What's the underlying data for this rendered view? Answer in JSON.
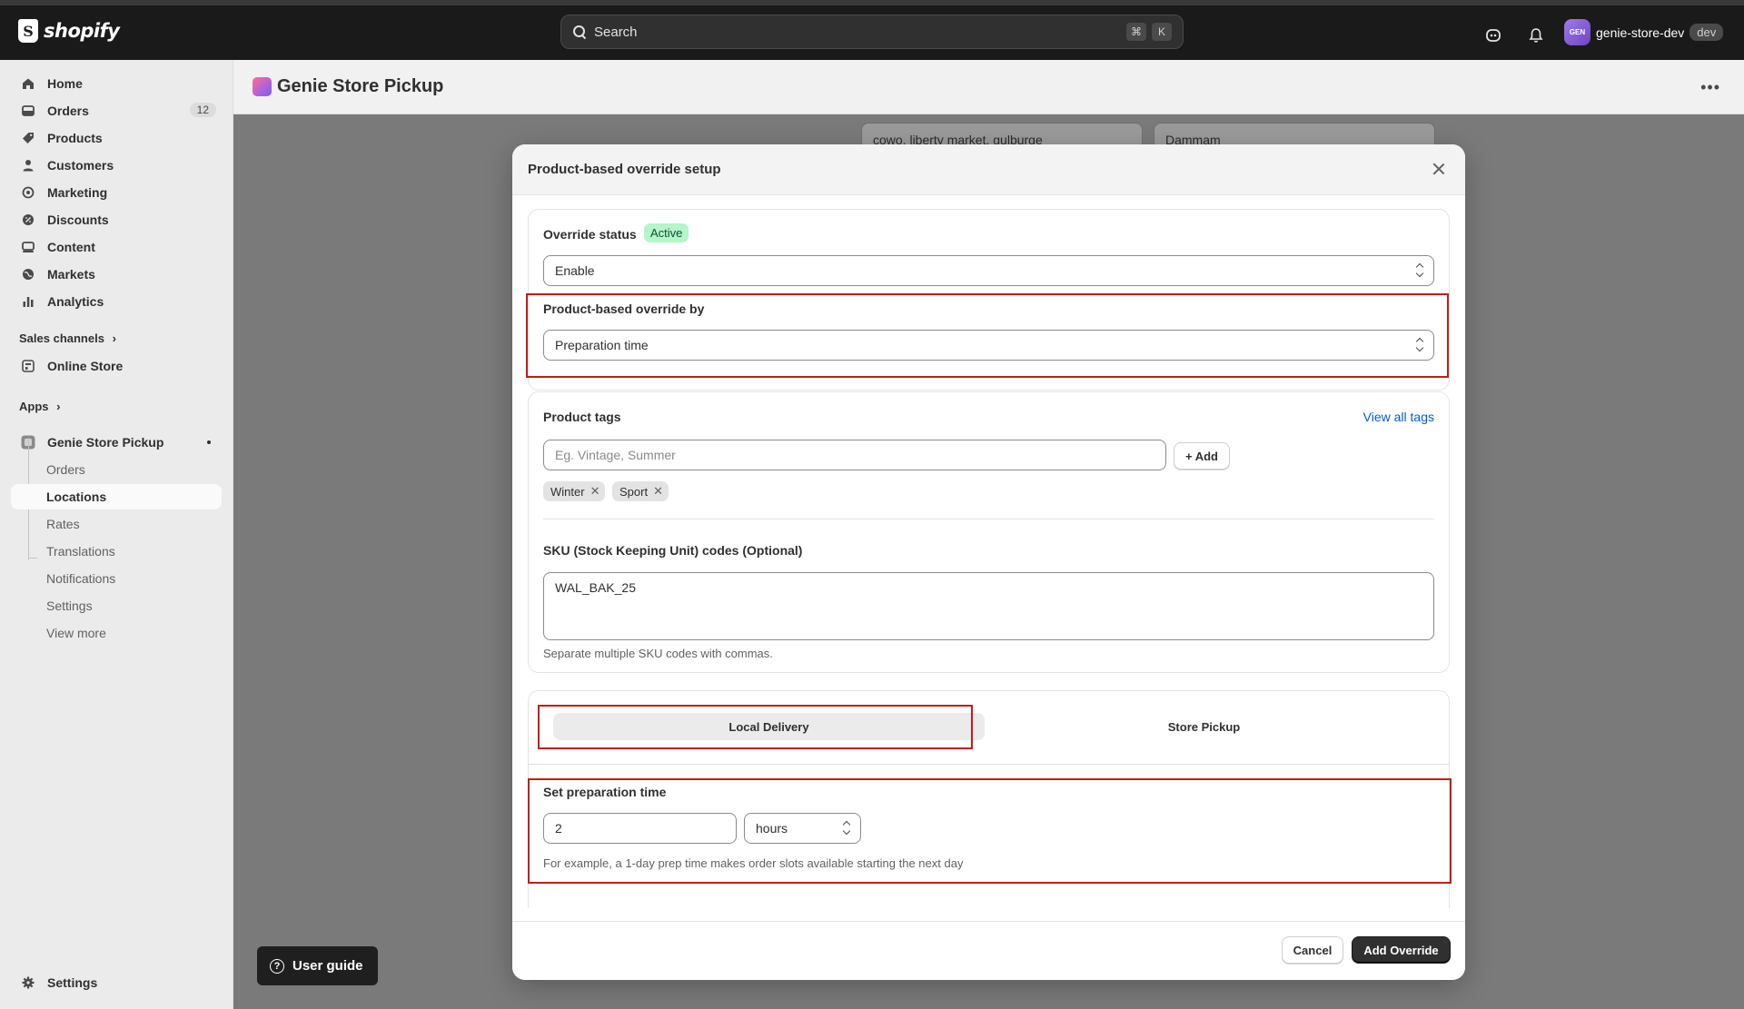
{
  "topbar": {
    "logo_text": "shopify",
    "search_placeholder": "Search",
    "shortcut_keys": [
      "⌘",
      "K"
    ],
    "store_avatar": "GEN",
    "store_name": "genie-store-dev",
    "store_tag": "dev"
  },
  "sidebar": {
    "items": [
      {
        "label": "Home",
        "icon": "home-icon"
      },
      {
        "label": "Orders",
        "icon": "orders-icon",
        "badge": "12"
      },
      {
        "label": "Products",
        "icon": "tag-icon"
      },
      {
        "label": "Customers",
        "icon": "person-icon"
      },
      {
        "label": "Marketing",
        "icon": "target-icon"
      },
      {
        "label": "Discounts",
        "icon": "discount-icon"
      },
      {
        "label": "Content",
        "icon": "content-icon"
      },
      {
        "label": "Markets",
        "icon": "globe-icon"
      },
      {
        "label": "Analytics",
        "icon": "bar-chart-icon"
      }
    ],
    "sales_channels_label": "Sales channels",
    "online_store_label": "Online Store",
    "apps_label": "Apps",
    "app_name": "Genie Store Pickup",
    "app_subitems": [
      "Orders",
      "Locations",
      "Rates",
      "Translations",
      "Notifications",
      "Settings",
      "View more"
    ],
    "active_subitem": "Locations",
    "settings_label": "Settings"
  },
  "page": {
    "title": "Genie Store Pickup",
    "bg_field_1": "cowo, liberty market, gulburge",
    "bg_field_2": "Dammam",
    "user_guide_label": "User guide"
  },
  "modal": {
    "title": "Product-based override setup",
    "override_status_label": "Override status",
    "override_status_badge": "Active",
    "override_status_value": "Enable",
    "override_by_label": "Product-based override by",
    "override_by_value": "Preparation time",
    "product_tags_label": "Product tags",
    "view_all_tags": "View all tags",
    "tags_placeholder": "Eg. Vintage, Summer",
    "add_button": "+ Add",
    "tags": [
      "Winter",
      "Sport"
    ],
    "sku_label": "SKU (Stock Keeping Unit) codes (Optional)",
    "sku_value": "WAL_BAK_25",
    "sku_help": "Separate multiple SKU codes with commas.",
    "tabs": [
      "Local Delivery",
      "Store Pickup"
    ],
    "selected_tab": "Local Delivery",
    "prep_label": "Set preparation time",
    "prep_value": "2",
    "prep_unit": "hours",
    "prep_help": "For example, a 1-day prep time makes order slots available starting the next day",
    "cancel_button": "Cancel",
    "add_override_button": "Add Override"
  },
  "colors": {
    "highlight": "#c31c1c",
    "link": "#005bd3",
    "active_badge_bg": "#b4f5c9"
  }
}
